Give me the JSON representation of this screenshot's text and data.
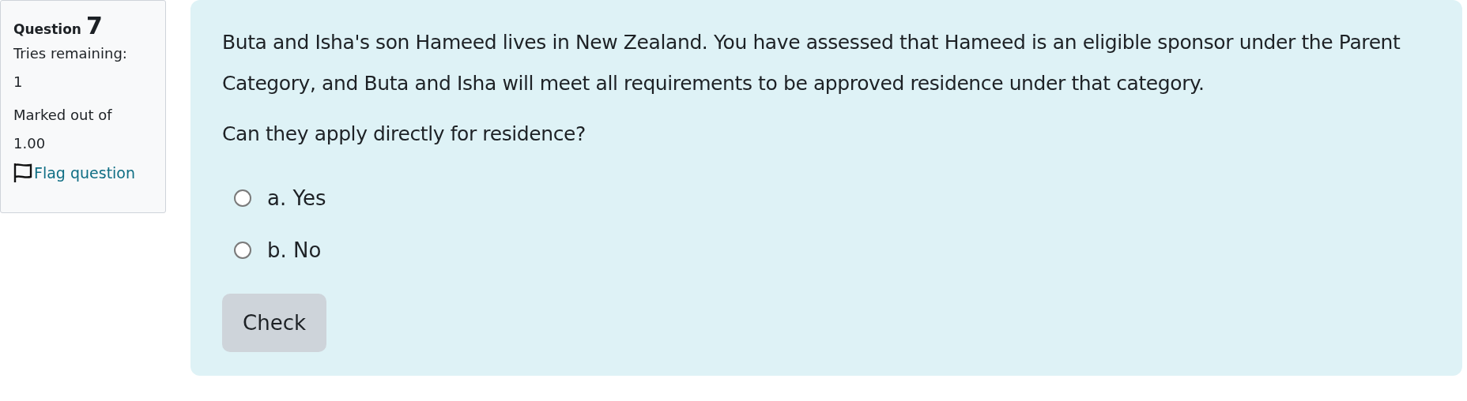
{
  "info": {
    "label": "Question",
    "number": "7",
    "tries_label": "Tries remaining:",
    "tries": "1",
    "marked_label": "Marked out of",
    "marked": "1.00",
    "flag": "Flag question"
  },
  "question": {
    "paragraphs": [
      "Buta and Isha's son Hameed lives in New Zealand. You have assessed that Hameed is an eligible sponsor under the Parent Category, and Buta and Isha will meet all requirements to be approved residence under that category.",
      "Can they apply directly for residence?"
    ],
    "options": [
      {
        "label": "a. Yes",
        "selected": false
      },
      {
        "label": "b. No",
        "selected": false
      }
    ],
    "button": "Check"
  }
}
